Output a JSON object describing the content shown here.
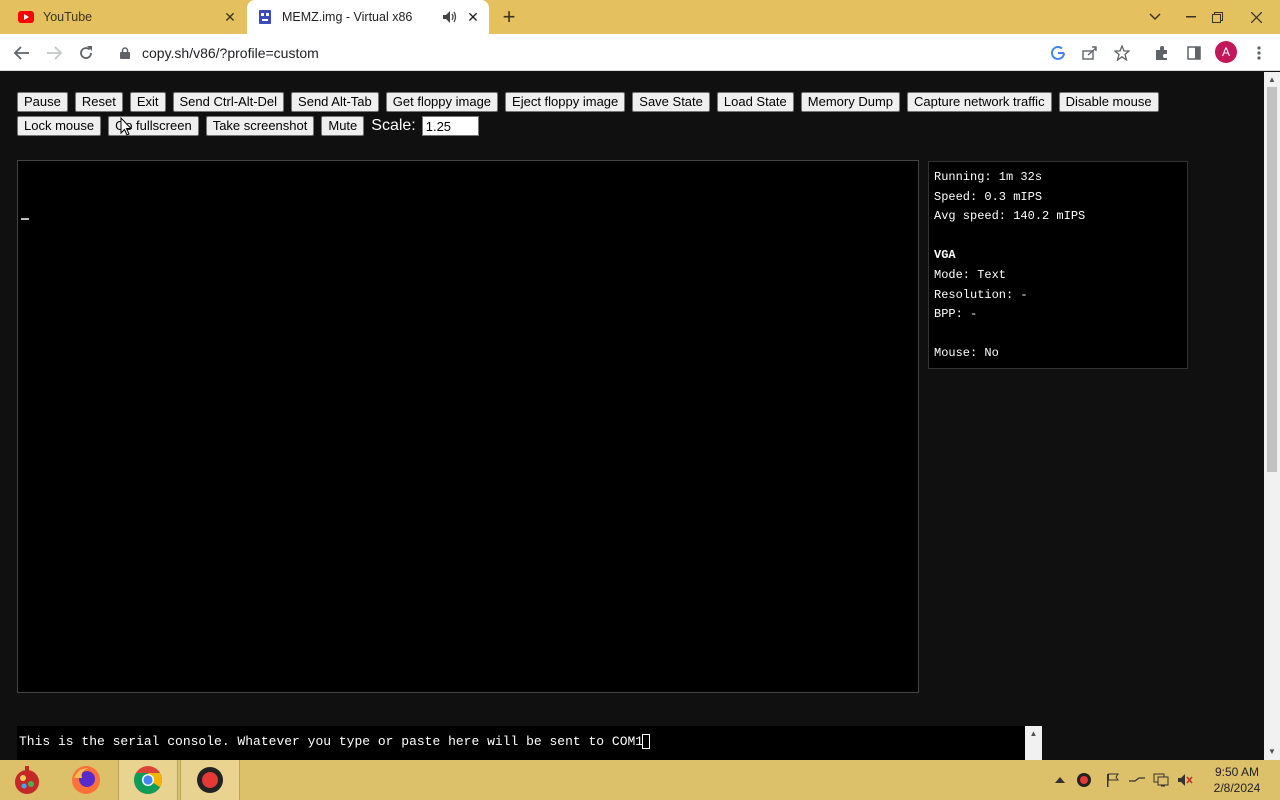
{
  "browser": {
    "tabs": [
      {
        "title": "YouTube",
        "active": false,
        "icon": "youtube-icon"
      },
      {
        "title": "MEMZ.img - Virtual x86",
        "active": true,
        "icon": "v86-icon",
        "audio": true
      }
    ],
    "url": "copy.sh/v86/?profile=custom",
    "avatar_letter": "A"
  },
  "controls": {
    "row1": [
      "Pause",
      "Reset",
      "Exit",
      "Send Ctrl-Alt-Del",
      "Send Alt-Tab",
      "Get floppy image",
      "Eject floppy image",
      "Save State",
      "Load State",
      "Memory Dump",
      "Capture network traffic",
      "Disable mouse"
    ],
    "row2": [
      "Lock mouse",
      "Go fullscreen",
      "Take screenshot",
      "Mute"
    ],
    "scale_label": "Scale:",
    "scale_value": "1.25"
  },
  "info": {
    "running": "Running: 1m 32s",
    "speed": "Speed: 0.3 mIPS",
    "avg_speed": "Avg speed: 140.2 mIPS",
    "vga_title": "VGA",
    "mode": "Mode: Text",
    "resolution": "Resolution: -",
    "bpp": "BPP: -",
    "mouse": "Mouse: No"
  },
  "serial": {
    "text": "This is the serial console. Whatever you type or paste here will be sent to COM1"
  },
  "taskbar": {
    "time": "9:50 AM",
    "date": "2/8/2024"
  }
}
